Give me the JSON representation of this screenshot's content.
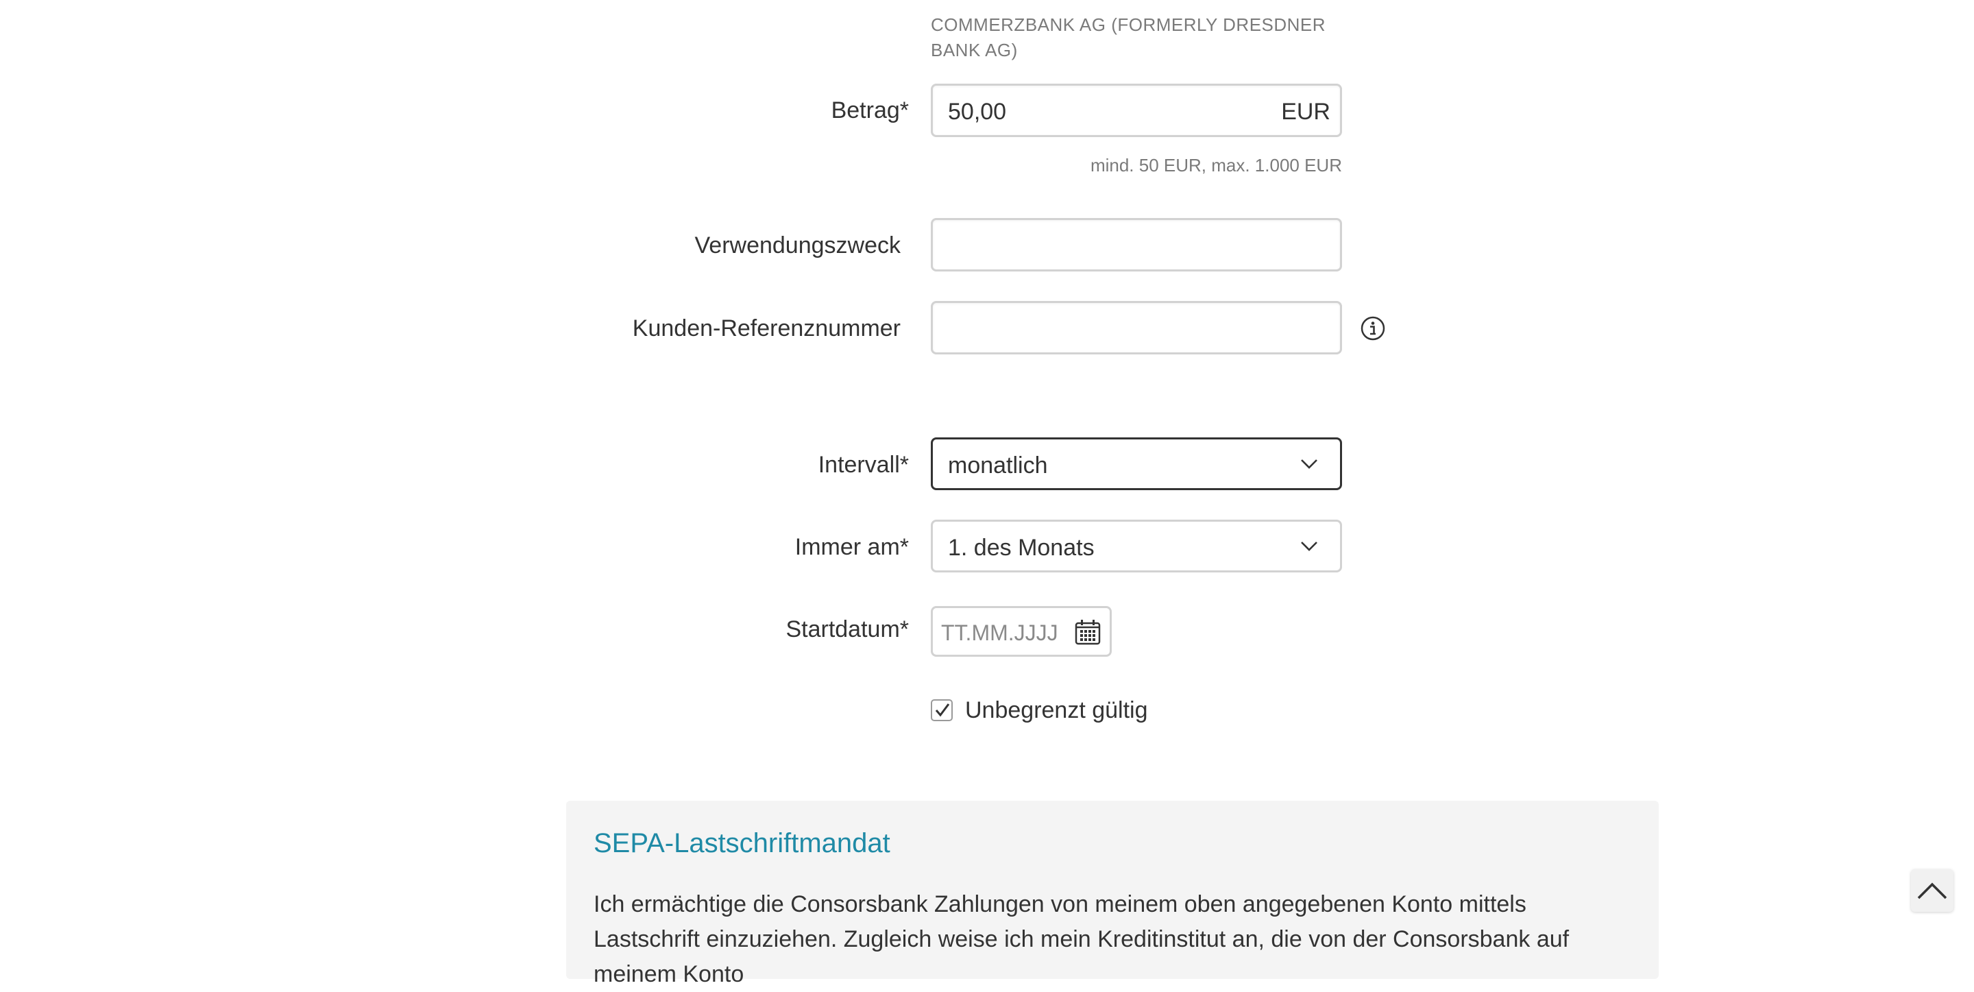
{
  "recipient": {
    "bank_name": "COMMERZBANK AG (FORMERLY DRESDNER BANK AG)"
  },
  "amount": {
    "label": "Betrag*",
    "value": "50,00",
    "currency": "EUR",
    "hint": "mind. 50 EUR, max. 1.000 EUR"
  },
  "purpose": {
    "label": "Verwendungszweck",
    "value": ""
  },
  "customer_reference": {
    "label": "Kunden-Referenznummer",
    "value": "",
    "icon": "info-icon"
  },
  "interval": {
    "label": "Intervall*",
    "selected": "monatlich",
    "icon": "chevron-down-icon"
  },
  "day": {
    "label": "Immer am*",
    "selected": "1. des Monats",
    "icon": "chevron-down-icon"
  },
  "start_date": {
    "label": "Startdatum*",
    "placeholder": "TT.MM.JJJJ",
    "icon": "calendar-icon"
  },
  "unlimited": {
    "label": "Unbegrenzt gültig",
    "checked": true
  },
  "sepa": {
    "title": "SEPA-Lastschriftmandat",
    "text": "Ich ermächtige die Consorsbank Zahlungen von meinem oben angegebenen Konto mittels Lastschrift einzuziehen. Zugleich weise ich mein Kreditinstitut an, die von der Consorsbank auf meinem Konto"
  },
  "scroll_top": {
    "icon": "chevron-up-icon"
  },
  "colors": {
    "accent": "#1f8aa6",
    "text": "#333333",
    "muted": "#7a7a7a",
    "border": "#d2d2d2",
    "panel": "#f4f4f4"
  }
}
